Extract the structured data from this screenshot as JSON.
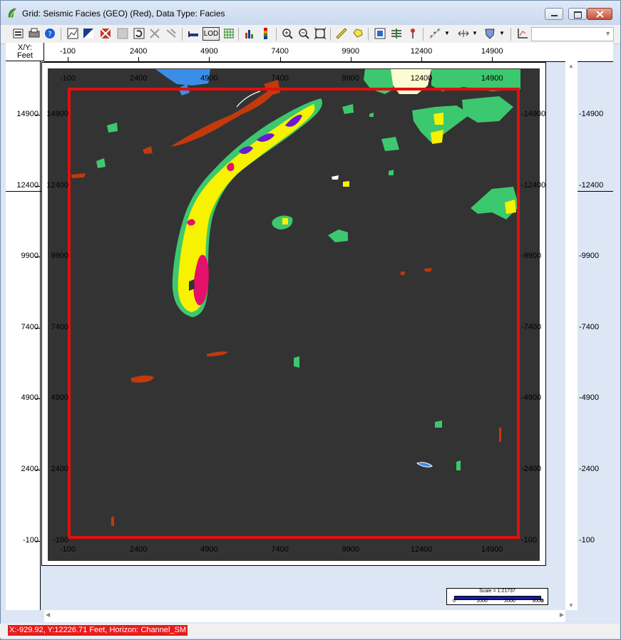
{
  "window": {
    "title": "Grid: Seismic Facies (GEO) (Red), Data Type: Facies",
    "controls": [
      "minimize",
      "maximize",
      "close"
    ]
  },
  "toolbar": {
    "lod_label": "LOD",
    "combo_value": ""
  },
  "corner": {
    "line1": "X/Y:",
    "line2": "Feet"
  },
  "axes": {
    "x_ticks": [
      "-100",
      "2400",
      "4900",
      "7400",
      "9900",
      "12400",
      "14900"
    ],
    "y_ticks": [
      "14900",
      "12400",
      "9900",
      "7400",
      "4900",
      "2400",
      "-100"
    ]
  },
  "scale_bar": {
    "title": "Scale = 1:21737",
    "ticks": [
      "0",
      "1000",
      "2000",
      "3000"
    ],
    "unit": "ft"
  },
  "status": {
    "text": "X:-929.92, Y:12226.71 Feet, Horizon: Channel_SM"
  },
  "colors": {
    "map_background": "#333333",
    "boundary": "#e01010",
    "facies_green": "#3cc86e",
    "facies_yellow": "#f6f200",
    "facies_orange": "#c23a0c",
    "facies_magenta": "#e4106a",
    "facies_purple": "#6a1ad0",
    "facies_blue": "#3a8ee8",
    "facies_cream": "#fdfbd0"
  }
}
